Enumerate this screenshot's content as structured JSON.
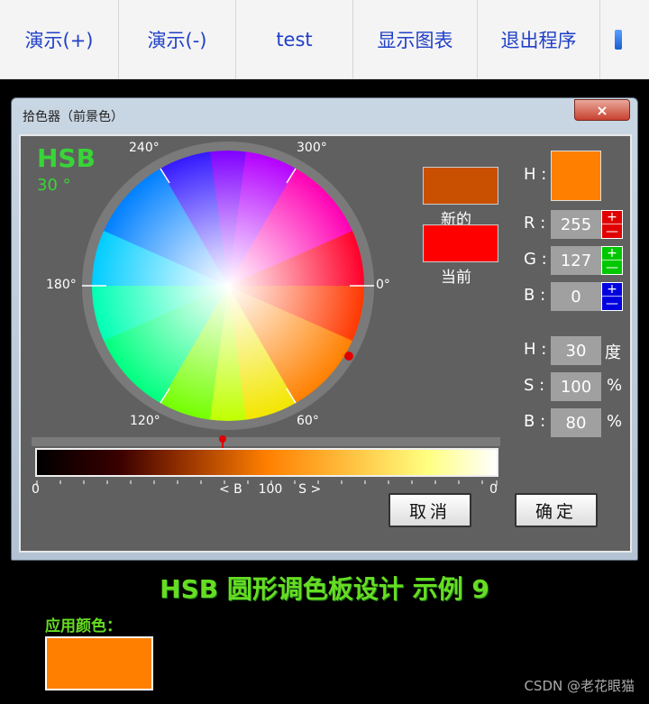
{
  "toolbar": {
    "buttons": [
      "演示(+)",
      "演示(-)",
      "test",
      "显示图表",
      "退出程序"
    ]
  },
  "window": {
    "title": "拾色器（前景色）",
    "close": "×"
  },
  "picker": {
    "mode": "HSB",
    "angle_text": "30 °",
    "wheel_labels": {
      "a0": "0°",
      "a60": "60°",
      "a120": "120°",
      "a180": "180°",
      "a240": "240°",
      "a300": "300°"
    },
    "new_label": "新的",
    "current_label": "当前",
    "new_color": "#c85000",
    "current_color": "#ff0000",
    "preview_color": "#ff7f00",
    "rgb": {
      "r_label": "R :",
      "r": "255",
      "g_label": "G :",
      "g": "127",
      "b_label": "B :",
      "b": "0"
    },
    "hsb": {
      "h_label": "H :",
      "h": "30",
      "h_unit": "度",
      "s_label": "S :",
      "s": "100",
      "s_unit": "%",
      "b_label": "B :",
      "b": "80",
      "b_unit": "%"
    },
    "h_preview_label": "H :",
    "plus": "+",
    "minus": "—",
    "bar_left": "0",
    "bar_right": "0",
    "bar_center": "< B    100    S >",
    "cancel": "取消",
    "ok": "确定"
  },
  "footer": {
    "title": "HSB 圆形调色板设计 示例 9",
    "applied_label": "应用颜色：",
    "applied_color": "#ff7f00",
    "watermark": "CSDN @老花眼猫"
  }
}
